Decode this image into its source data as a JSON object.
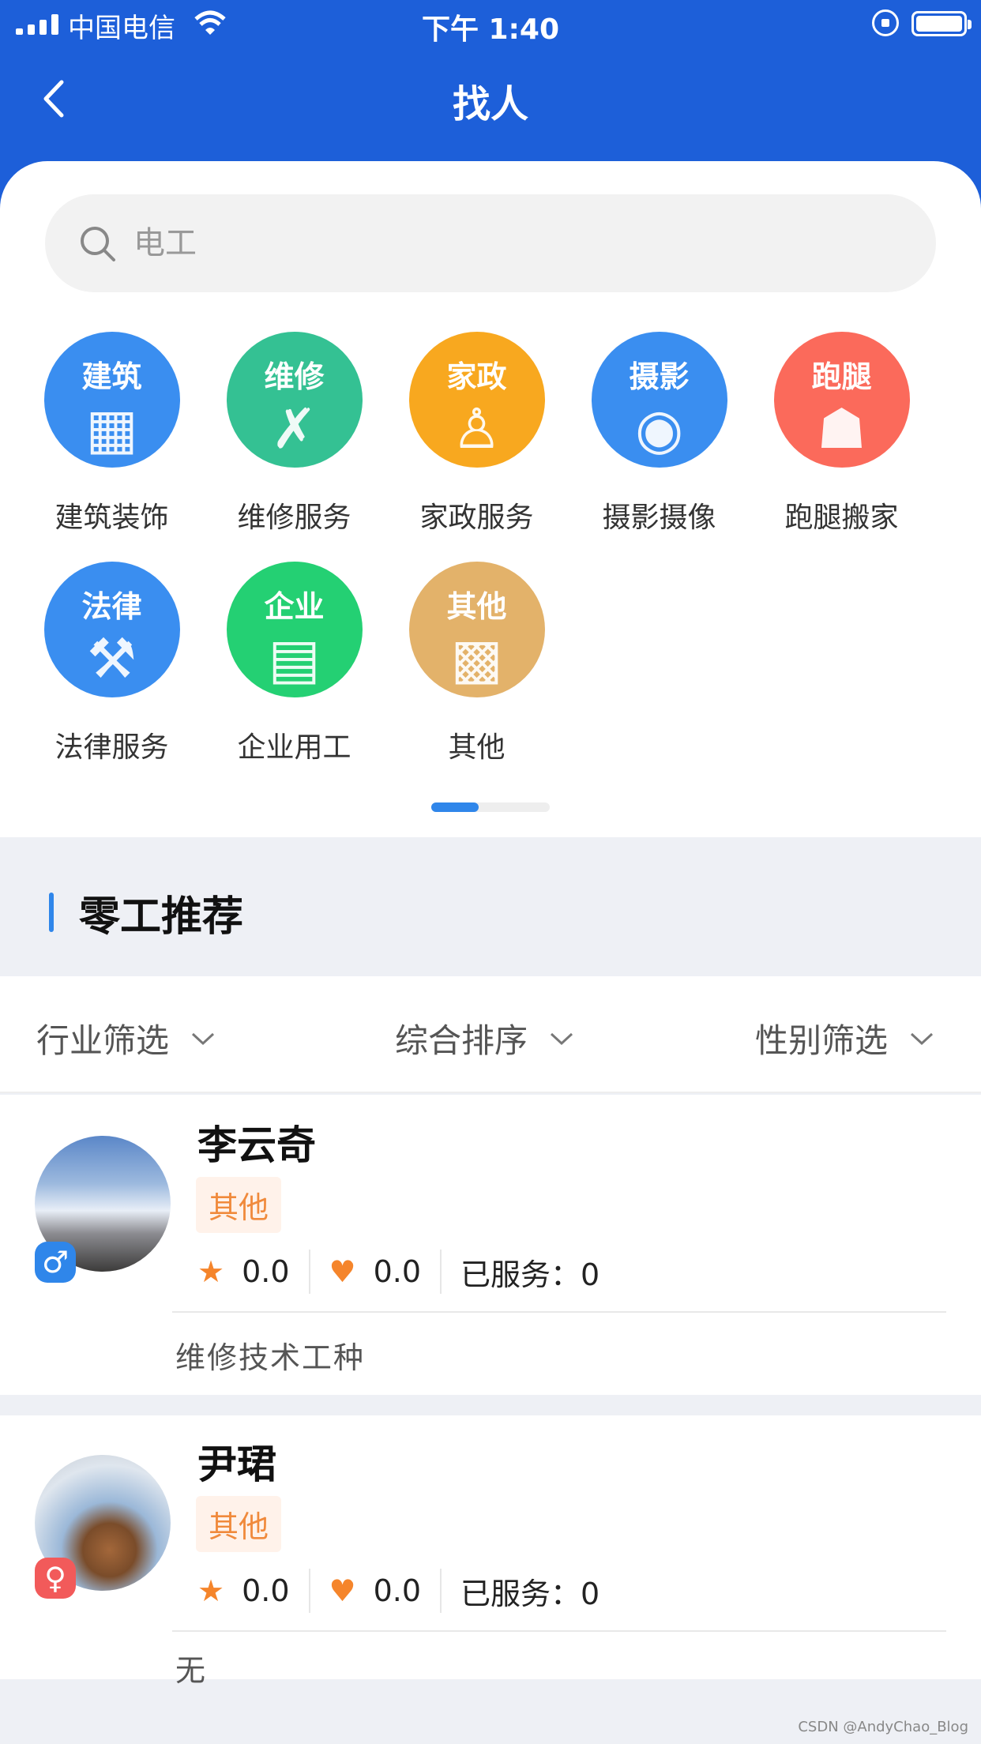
{
  "status_bar": {
    "carrier": "中国电信",
    "time": "下午 1:40"
  },
  "nav": {
    "title": "找人"
  },
  "search": {
    "placeholder": "电工"
  },
  "categories": [
    {
      "badge": "建筑",
      "label": "建筑装饰",
      "color": "#3a8ef0",
      "icon": "building-icon"
    },
    {
      "badge": "维修",
      "label": "维修服务",
      "color": "#34c193",
      "icon": "wrench-screwdriver-icon"
    },
    {
      "badge": "家政",
      "label": "家政服务",
      "color": "#f8a81f",
      "icon": "cleaner-icon"
    },
    {
      "badge": "摄影",
      "label": "摄影摄像",
      "color": "#3a8ef0",
      "icon": "camera-icon"
    },
    {
      "badge": "跑腿",
      "label": "跑腿搬家",
      "color": "#fb6a5b",
      "icon": "courier-icon"
    },
    {
      "badge": "法律",
      "label": "法律服务",
      "color": "#3a8ef0",
      "icon": "gavel-icon"
    },
    {
      "badge": "企业",
      "label": "企业用工",
      "color": "#24d073",
      "icon": "company-icon"
    },
    {
      "badge": "其他",
      "label": "其他",
      "color": "#e3b26a",
      "icon": "other-grid-icon"
    }
  ],
  "section": {
    "title": "零工推荐"
  },
  "filters": [
    {
      "label": "行业筛选"
    },
    {
      "label": "综合排序"
    },
    {
      "label": "性别筛选"
    }
  ],
  "workers": [
    {
      "name": "李云奇",
      "tag": "其他",
      "rating": "0.0",
      "favor": "0.0",
      "served": "已服务：0",
      "description": "维修技术工种",
      "gender": "male"
    },
    {
      "name": "尹珺",
      "tag": "其他",
      "rating": "0.0",
      "favor": "0.0",
      "served": "已服务：0",
      "description": "无",
      "gender": "female"
    }
  ],
  "colors": {
    "header_blue": "#1d5fd9",
    "accent_blue": "#2f86ea",
    "tag_orange": "#f08a3c",
    "male_badge": "#2f86ea",
    "female_badge": "#f25a5a"
  },
  "watermark": "CSDN @AndyChao_Blog"
}
